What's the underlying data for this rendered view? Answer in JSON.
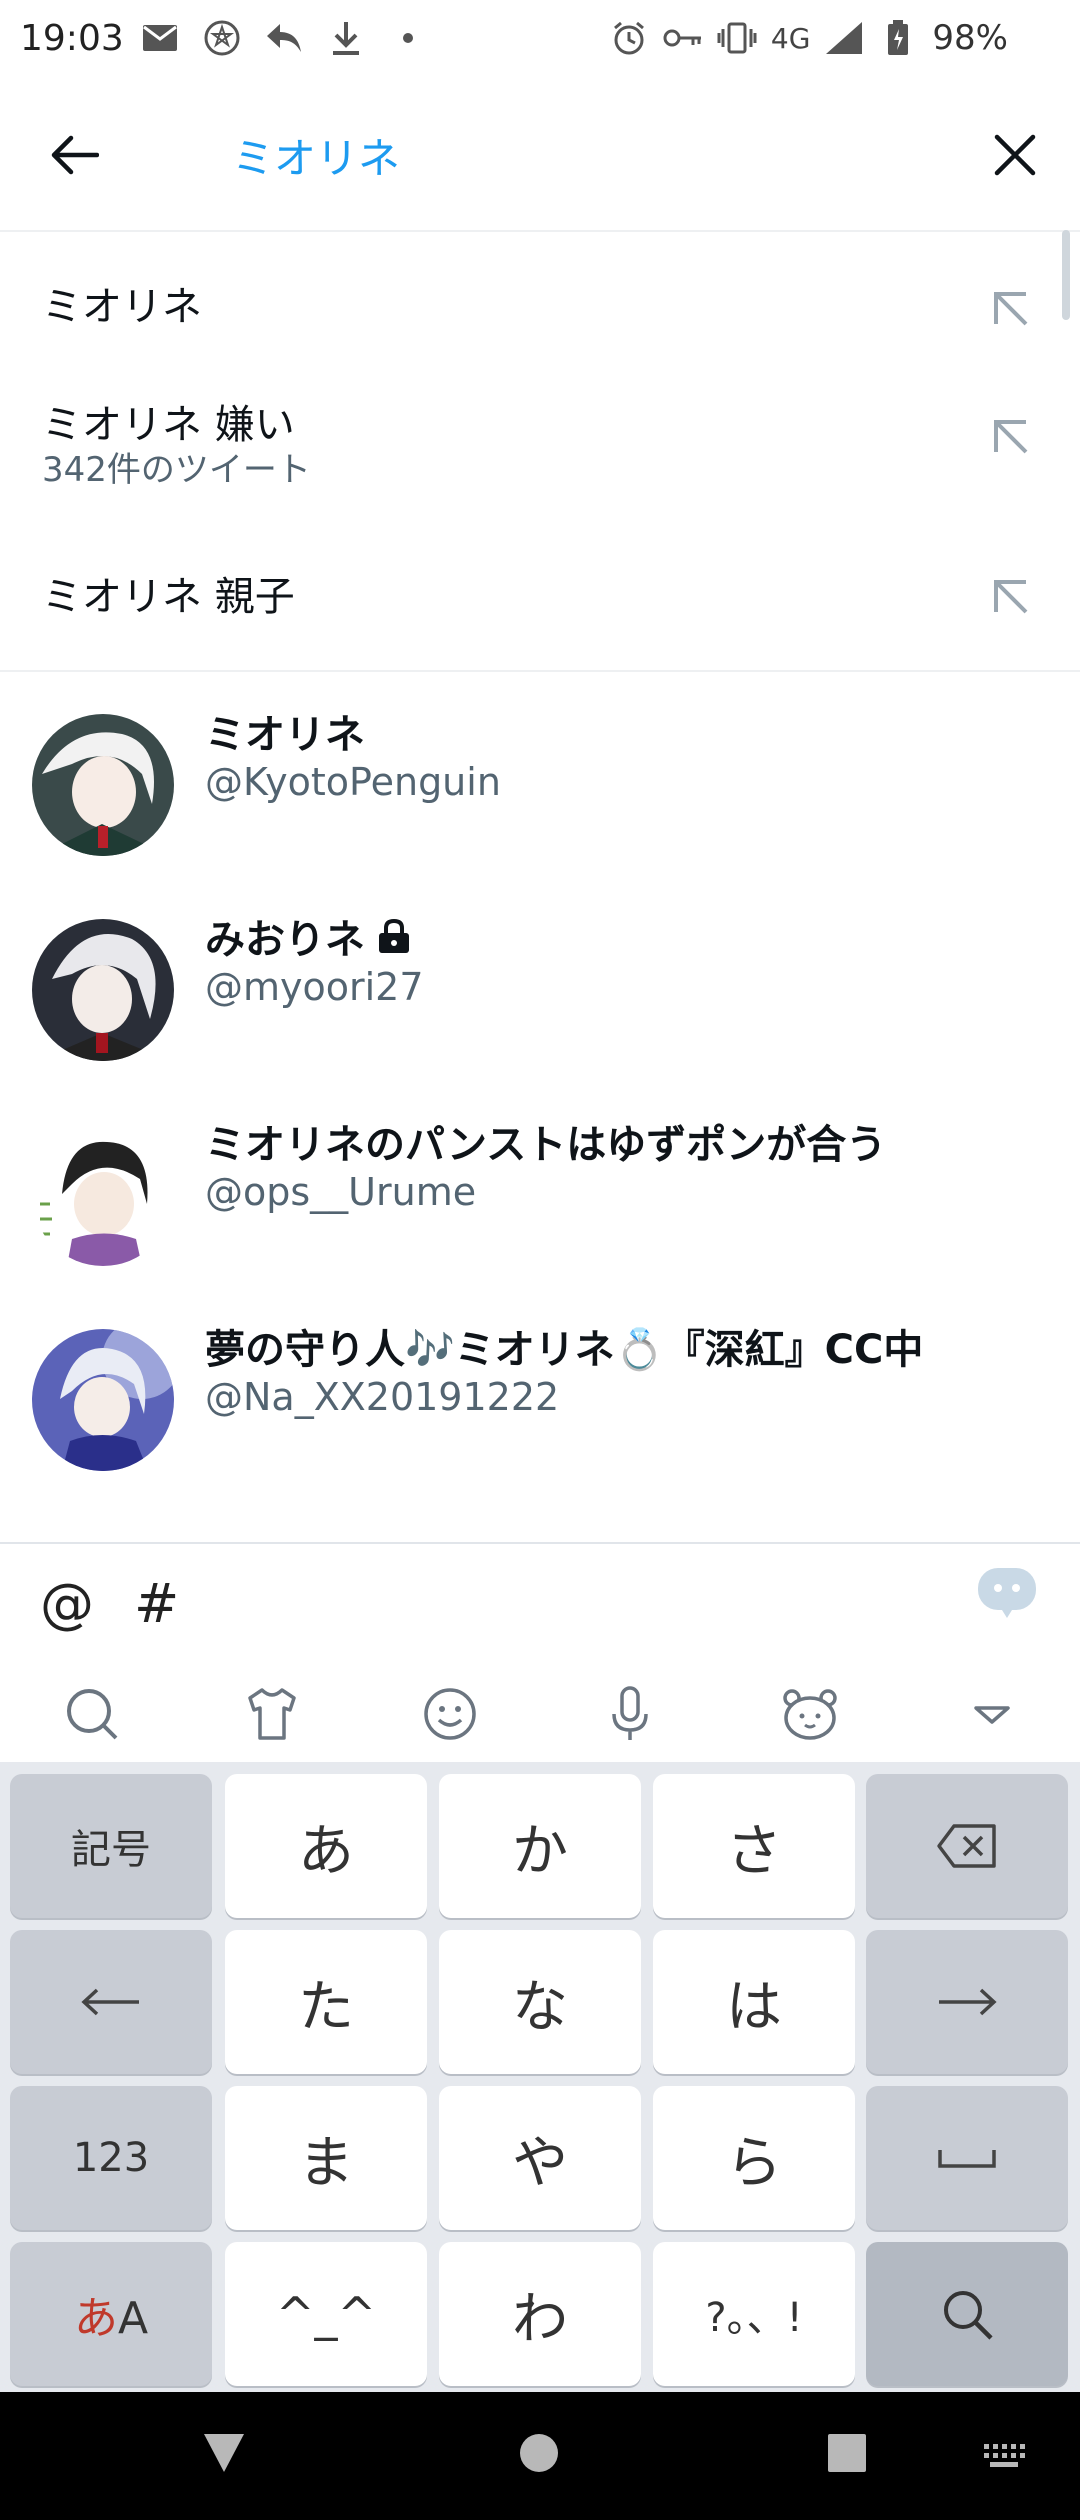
{
  "status_bar": {
    "time": "19:03",
    "network": "4G",
    "battery": "98%",
    "left_icons": [
      "mail-icon",
      "app-icon",
      "reply-icon",
      "download-icon",
      "dot-icon"
    ],
    "right_icons": [
      "alarm-icon",
      "key-icon",
      "vibrate-icon",
      "signal-icon",
      "battery-icon"
    ]
  },
  "search": {
    "query": "ミオリネ"
  },
  "suggestions": [
    {
      "text": "ミオリネ",
      "sub": ""
    },
    {
      "text": "ミオリネ 嫌い",
      "sub": "342件のツイート"
    },
    {
      "text": "ミオリネ 親子",
      "sub": ""
    }
  ],
  "users": [
    {
      "name": "ミオリネ",
      "handle": "@KyotoPenguin",
      "locked": false
    },
    {
      "name": "みおりネ",
      "handle": "@myoori27",
      "locked": true
    },
    {
      "name": "ミオリネのパンストはゆずポンが合う",
      "handle": "@ops__Urume",
      "locked": false
    },
    {
      "name": "夢の守り人🎶ミオリネ💍『深紅』CC中",
      "handle": "@Na_XX20191222",
      "locked": false
    }
  ],
  "keyboard": {
    "symbols": [
      "@",
      "#"
    ],
    "toolbar_icons": [
      "search-icon",
      "shirt-icon",
      "emoji-icon",
      "mic-icon",
      "bear-icon",
      "collapse-icon"
    ],
    "rows": [
      [
        "記号",
        "あ",
        "か",
        "さ",
        "⌫"
      ],
      [
        "←",
        "た",
        "な",
        "は",
        "→"
      ],
      [
        "123",
        "ま",
        "や",
        "ら",
        "␣"
      ],
      [
        "あA",
        "^_^",
        "わ",
        "?。、!",
        "🔍"
      ]
    ]
  }
}
